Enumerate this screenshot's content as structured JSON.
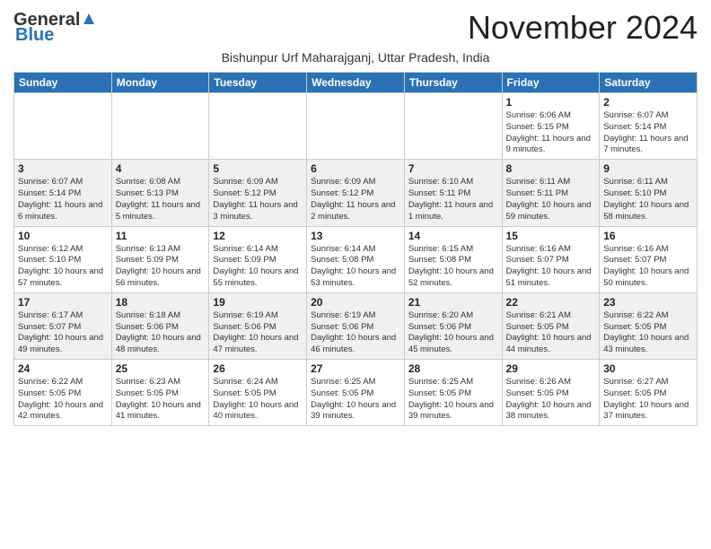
{
  "logo": {
    "general": "General",
    "blue": "Blue"
  },
  "title": "November 2024",
  "subtitle": "Bishunpur Urf Maharajganj, Uttar Pradesh, India",
  "days_header": [
    "Sunday",
    "Monday",
    "Tuesday",
    "Wednesday",
    "Thursday",
    "Friday",
    "Saturday"
  ],
  "weeks": [
    [
      {
        "num": "",
        "info": ""
      },
      {
        "num": "",
        "info": ""
      },
      {
        "num": "",
        "info": ""
      },
      {
        "num": "",
        "info": ""
      },
      {
        "num": "",
        "info": ""
      },
      {
        "num": "1",
        "info": "Sunrise: 6:06 AM\nSunset: 5:15 PM\nDaylight: 11 hours and 9 minutes."
      },
      {
        "num": "2",
        "info": "Sunrise: 6:07 AM\nSunset: 5:14 PM\nDaylight: 11 hours and 7 minutes."
      }
    ],
    [
      {
        "num": "3",
        "info": "Sunrise: 6:07 AM\nSunset: 5:14 PM\nDaylight: 11 hours and 6 minutes."
      },
      {
        "num": "4",
        "info": "Sunrise: 6:08 AM\nSunset: 5:13 PM\nDaylight: 11 hours and 5 minutes."
      },
      {
        "num": "5",
        "info": "Sunrise: 6:09 AM\nSunset: 5:12 PM\nDaylight: 11 hours and 3 minutes."
      },
      {
        "num": "6",
        "info": "Sunrise: 6:09 AM\nSunset: 5:12 PM\nDaylight: 11 hours and 2 minutes."
      },
      {
        "num": "7",
        "info": "Sunrise: 6:10 AM\nSunset: 5:11 PM\nDaylight: 11 hours and 1 minute."
      },
      {
        "num": "8",
        "info": "Sunrise: 6:11 AM\nSunset: 5:11 PM\nDaylight: 10 hours and 59 minutes."
      },
      {
        "num": "9",
        "info": "Sunrise: 6:11 AM\nSunset: 5:10 PM\nDaylight: 10 hours and 58 minutes."
      }
    ],
    [
      {
        "num": "10",
        "info": "Sunrise: 6:12 AM\nSunset: 5:10 PM\nDaylight: 10 hours and 57 minutes."
      },
      {
        "num": "11",
        "info": "Sunrise: 6:13 AM\nSunset: 5:09 PM\nDaylight: 10 hours and 56 minutes."
      },
      {
        "num": "12",
        "info": "Sunrise: 6:14 AM\nSunset: 5:09 PM\nDaylight: 10 hours and 55 minutes."
      },
      {
        "num": "13",
        "info": "Sunrise: 6:14 AM\nSunset: 5:08 PM\nDaylight: 10 hours and 53 minutes."
      },
      {
        "num": "14",
        "info": "Sunrise: 6:15 AM\nSunset: 5:08 PM\nDaylight: 10 hours and 52 minutes."
      },
      {
        "num": "15",
        "info": "Sunrise: 6:16 AM\nSunset: 5:07 PM\nDaylight: 10 hours and 51 minutes."
      },
      {
        "num": "16",
        "info": "Sunrise: 6:16 AM\nSunset: 5:07 PM\nDaylight: 10 hours and 50 minutes."
      }
    ],
    [
      {
        "num": "17",
        "info": "Sunrise: 6:17 AM\nSunset: 5:07 PM\nDaylight: 10 hours and 49 minutes."
      },
      {
        "num": "18",
        "info": "Sunrise: 6:18 AM\nSunset: 5:06 PM\nDaylight: 10 hours and 48 minutes."
      },
      {
        "num": "19",
        "info": "Sunrise: 6:19 AM\nSunset: 5:06 PM\nDaylight: 10 hours and 47 minutes."
      },
      {
        "num": "20",
        "info": "Sunrise: 6:19 AM\nSunset: 5:06 PM\nDaylight: 10 hours and 46 minutes."
      },
      {
        "num": "21",
        "info": "Sunrise: 6:20 AM\nSunset: 5:06 PM\nDaylight: 10 hours and 45 minutes."
      },
      {
        "num": "22",
        "info": "Sunrise: 6:21 AM\nSunset: 5:05 PM\nDaylight: 10 hours and 44 minutes."
      },
      {
        "num": "23",
        "info": "Sunrise: 6:22 AM\nSunset: 5:05 PM\nDaylight: 10 hours and 43 minutes."
      }
    ],
    [
      {
        "num": "24",
        "info": "Sunrise: 6:22 AM\nSunset: 5:05 PM\nDaylight: 10 hours and 42 minutes."
      },
      {
        "num": "25",
        "info": "Sunrise: 6:23 AM\nSunset: 5:05 PM\nDaylight: 10 hours and 41 minutes."
      },
      {
        "num": "26",
        "info": "Sunrise: 6:24 AM\nSunset: 5:05 PM\nDaylight: 10 hours and 40 minutes."
      },
      {
        "num": "27",
        "info": "Sunrise: 6:25 AM\nSunset: 5:05 PM\nDaylight: 10 hours and 39 minutes."
      },
      {
        "num": "28",
        "info": "Sunrise: 6:25 AM\nSunset: 5:05 PM\nDaylight: 10 hours and 39 minutes."
      },
      {
        "num": "29",
        "info": "Sunrise: 6:26 AM\nSunset: 5:05 PM\nDaylight: 10 hours and 38 minutes."
      },
      {
        "num": "30",
        "info": "Sunrise: 6:27 AM\nSunset: 5:05 PM\nDaylight: 10 hours and 37 minutes."
      }
    ]
  ],
  "row_styles": [
    "row-white",
    "row-alt",
    "row-white",
    "row-alt",
    "row-white"
  ]
}
